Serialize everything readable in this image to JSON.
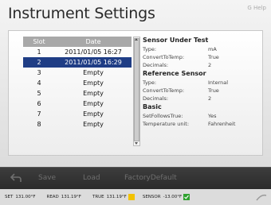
{
  "title": "Instrument Settings",
  "corner_label": "G Help",
  "slots": {
    "header": {
      "slot": "Slot",
      "date": "Date"
    },
    "rows": [
      {
        "slot": "1",
        "date": "2011/01/05 16:27"
      },
      {
        "slot": "2",
        "date": "2011/01/05 16:29"
      },
      {
        "slot": "3",
        "date": "Empty"
      },
      {
        "slot": "4",
        "date": "Empty"
      },
      {
        "slot": "5",
        "date": "Empty"
      },
      {
        "slot": "6",
        "date": "Empty"
      },
      {
        "slot": "7",
        "date": "Empty"
      },
      {
        "slot": "8",
        "date": "Empty"
      }
    ],
    "selected": "2"
  },
  "sensor_under_test": {
    "heading": "Sensor Under Test",
    "items": [
      {
        "k": "Type:",
        "v": "mA"
      },
      {
        "k": "ConvertToTemp:",
        "v": "True"
      },
      {
        "k": "Decimals:",
        "v": "2"
      }
    ]
  },
  "reference_sensor": {
    "heading": "Reference Sensor",
    "items": [
      {
        "k": "Type:",
        "v": "Internal"
      },
      {
        "k": "ConvertToTemp:",
        "v": "True"
      },
      {
        "k": "Decimals:",
        "v": "2"
      }
    ]
  },
  "basic": {
    "heading": "Basic",
    "items": [
      {
        "k": "SetFollowsTrue:",
        "v": "Yes"
      },
      {
        "k": "Temperature unit:",
        "v": "Fahrenheit"
      }
    ]
  },
  "toolbar": {
    "save": "Save",
    "load": "Load",
    "factory": "FactoryDefault"
  },
  "status": {
    "set_label": "SET",
    "set_value": "131.00°F",
    "read_label": "READ",
    "read_value": "131.19°F",
    "true_label": "TRUE",
    "true_value": "131.19°F",
    "sensor_label": "SENSOR",
    "sensor_value": "-13.00°F"
  },
  "colors": {
    "selected_row": "#1f3d85",
    "true_indicator": "#f2c200",
    "sensor_indicator": "#2fa12f"
  }
}
